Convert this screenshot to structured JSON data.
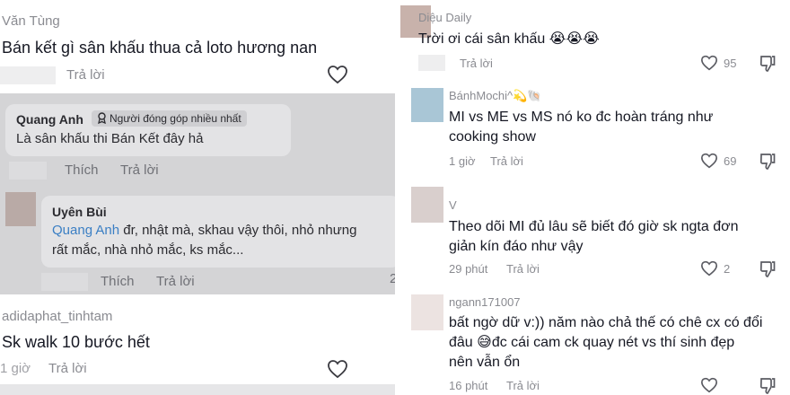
{
  "left": {
    "comment1": {
      "username": "Văn Tùng",
      "text": "Bán kết gì sân khấu thua cả loto hương nan",
      "reply_label": "Trả lời"
    },
    "reply_thread": {
      "reply1": {
        "username": "Quang Anh",
        "badge": "Người đóng góp nhiều nhất",
        "text": "Là sân khấu thi Bán Kết đây hả",
        "like_label": "Thích",
        "reply_label": "Trả lời"
      },
      "reply2": {
        "username": "Uyên Bùi",
        "mention": "Quang Anh",
        "text_line1": " đr, nhật mà, skhau vậy thôi, nhỏ nhưng",
        "text_line2": "rất mắc, nhà nhỏ mắc, ks mắc...",
        "like_label": "Thích",
        "reply_label": "Trả lời",
        "edge_char": "2"
      }
    },
    "comment2": {
      "username": "adidaphat_tinhtam",
      "text": "Sk walk 10 bước hết",
      "time": "1 giờ",
      "reply_label": "Trả lời"
    }
  },
  "right": {
    "comments": [
      {
        "username": "Diệu Daily",
        "text_line1": "Trời ơi cái sân khấu 😭😭😭",
        "text_line2": "",
        "text_line3": "",
        "time": "",
        "reply_label": "Trả lời",
        "likes": "95",
        "avatar_color": "#c8b2ab"
      },
      {
        "username": "BánhMochi^💫🐚",
        "text_line1": "MI vs ME vs MS nó ko đc hoàn tráng như",
        "text_line2": "cooking show",
        "text_line3": "",
        "time": "1 giờ",
        "reply_label": "Trả lời",
        "likes": "69",
        "avatar_color": "#a9c6d6"
      },
      {
        "username": "V",
        "text_line1": "Theo dõi MI đủ lâu sẽ biết đó giờ sk ngta đơn",
        "text_line2": "giản kín đáo như vậy",
        "text_line3": "",
        "time": "29 phút",
        "reply_label": "Trả lời",
        "likes": "2",
        "avatar_color": "#d9cfcd"
      },
      {
        "username": "ngann171007",
        "text_line1": "bất ngờ dữ v:)) năm nào chả thế có chê cx có đổi",
        "text_line2": "đâu 😅đc cái cam ck quay nét vs thí sinh đẹp",
        "text_line3": "nên vẫn ổn",
        "time": "16 phút",
        "reply_label": "Trả lời",
        "likes": "",
        "avatar_color": "#ece3e1"
      }
    ]
  },
  "colors": {
    "text_primary": "#161823",
    "text_secondary": "#8a8b91",
    "mention": "#3b7fc4",
    "thread_bg": "#d4d4d6"
  }
}
